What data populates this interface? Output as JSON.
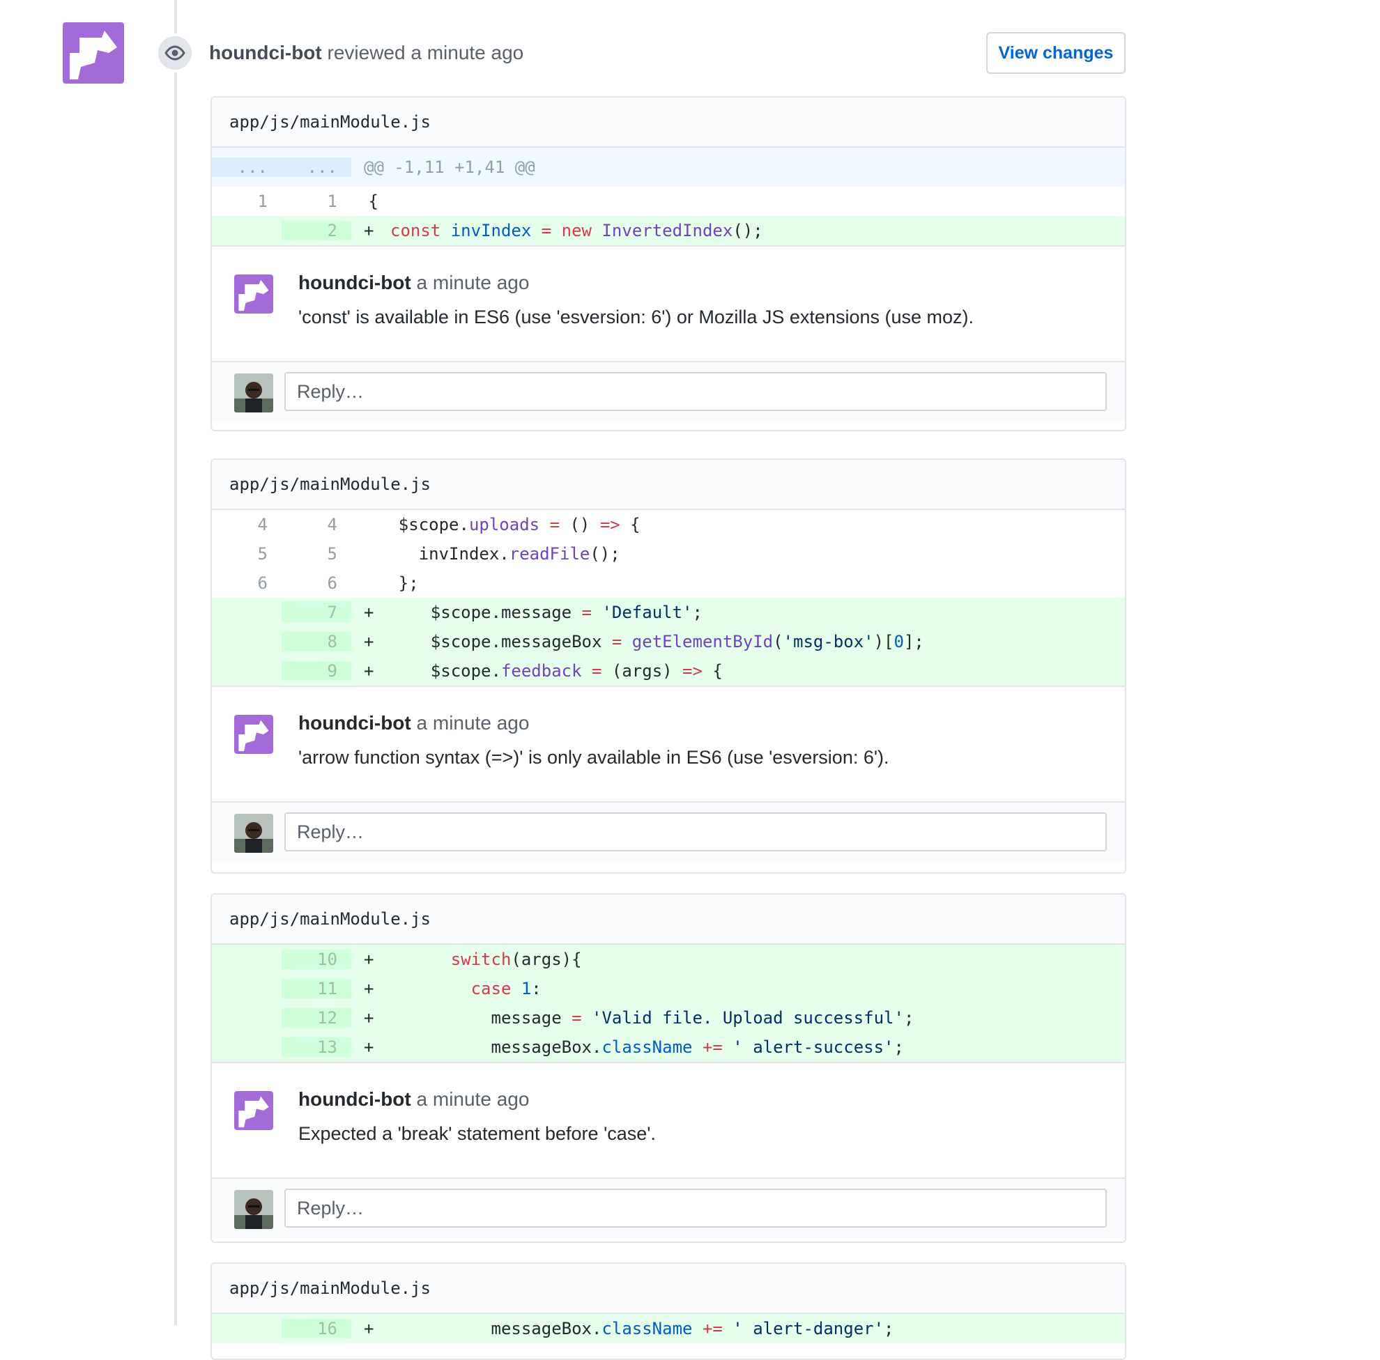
{
  "review": {
    "author": "houndci-bot",
    "action": "reviewed a minute ago",
    "view_changes_label": "View changes"
  },
  "threads": [
    {
      "file": "app/js/mainModule.js",
      "hunk": "@@ -1,11 +1,41 @@",
      "hunk_left": "...",
      "hunk_right": "...",
      "comment_author": "houndci-bot",
      "comment_time": "a minute ago",
      "comment_text": "'const' is available in ES6 (use 'esversion: 6') or Mozilla JS extensions (use moz).",
      "reply_placeholder": "Reply…"
    },
    {
      "file": "app/js/mainModule.js",
      "comment_author": "houndci-bot",
      "comment_time": "a minute ago",
      "comment_text": "'arrow function syntax (=>)' is only available in ES6 (use 'esversion: 6').",
      "reply_placeholder": "Reply…"
    },
    {
      "file": "app/js/mainModule.js",
      "comment_author": "houndci-bot",
      "comment_time": "a minute ago",
      "comment_text": "Expected a 'break' statement before 'case'.",
      "reply_placeholder": "Reply…"
    },
    {
      "file": "app/js/mainModule.js"
    }
  ],
  "line_numbers": {
    "t1": [
      [
        "1",
        "1"
      ],
      [
        "",
        "2"
      ]
    ],
    "t2": [
      [
        "4",
        "4"
      ],
      [
        "5",
        "5"
      ],
      [
        "6",
        "6"
      ],
      [
        "",
        "7"
      ],
      [
        "",
        "8"
      ],
      [
        "",
        "9"
      ]
    ],
    "t3": [
      [
        "",
        "10"
      ],
      [
        "",
        "11"
      ],
      [
        "",
        "12"
      ],
      [
        "",
        "13"
      ]
    ],
    "t4": [
      [
        "",
        "16"
      ]
    ]
  },
  "code": {
    "t1_l1": " {",
    "t2_l1": "    $scope.uploads = () => {",
    "t2_l2": "      invIndex.readFile();",
    "t2_l3": "    };",
    "t3_l3": "        message = 'Valid file. Upload successful';"
  },
  "icons": {
    "review": "eye-icon",
    "bot_avatar": "houndci-bot-avatar",
    "user_avatar": "user-avatar"
  },
  "colors": {
    "addition_bg": "#e6ffed",
    "addition_gutter": "#cdffd8",
    "hunk_bg": "#f1f8ff",
    "bot_purple": "#a46ad8",
    "link_blue": "#0366d6"
  }
}
